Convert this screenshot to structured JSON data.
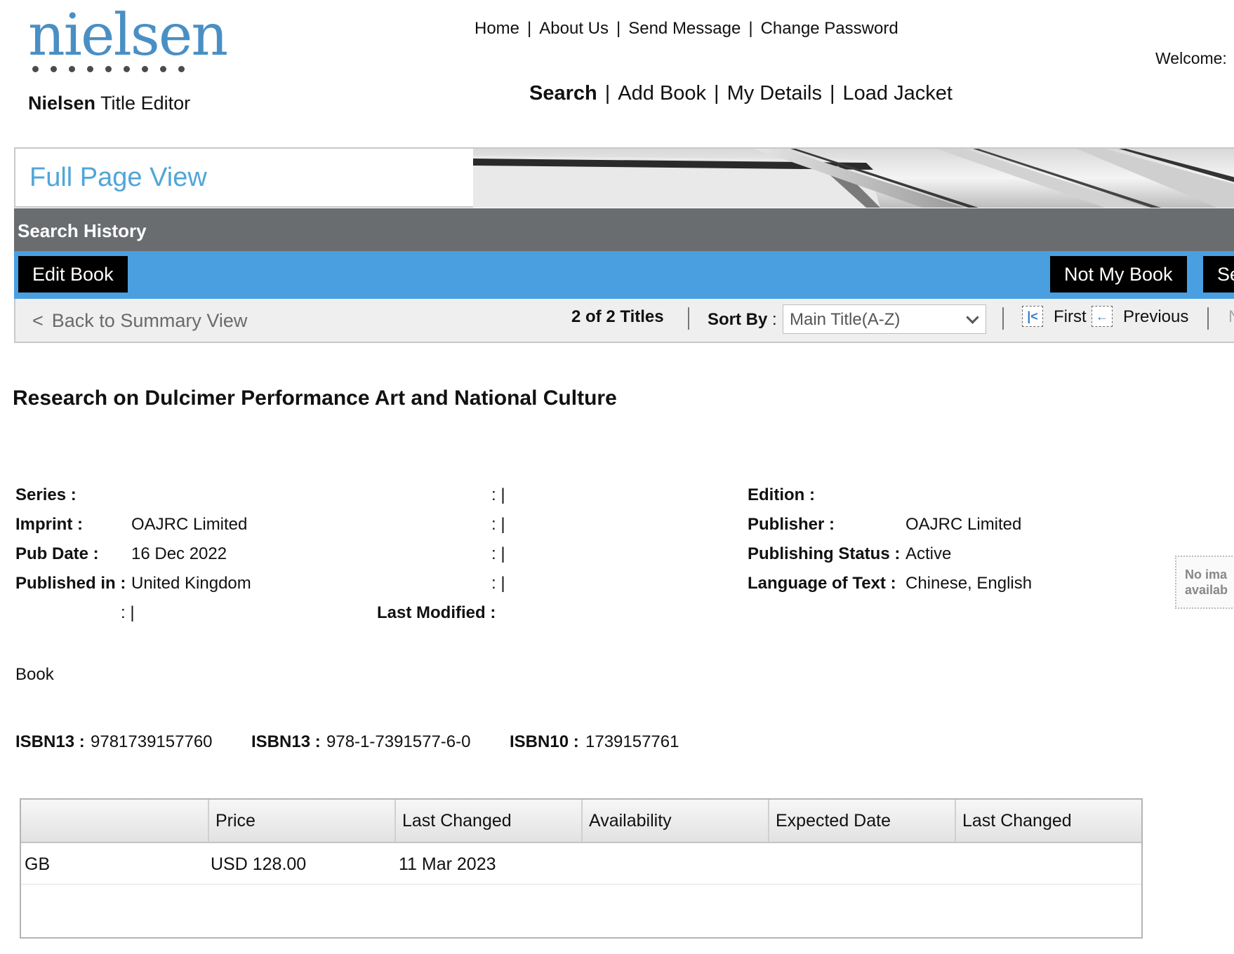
{
  "header": {
    "brand_logo_text": "nielsen",
    "app_title_bold": "Nielsen",
    "app_title_rest": "Title Editor",
    "top_links": [
      "Home",
      "About Us",
      "Send Message",
      "Change Password"
    ],
    "main_links": [
      "Search",
      "Add Book",
      "My Details",
      "Load Jacket"
    ],
    "welcome": "Welcome:"
  },
  "banner": {
    "title": "Full Page View",
    "history_label": "Search History"
  },
  "actions": {
    "edit_book": "Edit Book",
    "not_my_book": "Not My Book",
    "cut_button": "Se"
  },
  "pager": {
    "back_arrow": "<",
    "back_label": "Back to Summary View",
    "titles_count": "2 of 2 Titles",
    "sort_by_label": "Sort By",
    "sort_by_colon": ":",
    "sort_selected": "Main Title(A-Z)",
    "first_label": "First",
    "previous_label": "Previous",
    "next_partial": "N"
  },
  "book": {
    "title": "Research on Dulcimer Performance Art and National Culture",
    "series_label": "Series :",
    "series_value": "",
    "imprint_label": "Imprint :",
    "imprint_value": "OAJRC Limited",
    "pub_date_label": "Pub Date :",
    "pub_date_value": "16 Dec 2022",
    "published_in_label": "Published in :",
    "published_in_value": "United Kingdom",
    "colon_bar": ": |",
    "last_modified_label": "Last Modified :",
    "edition_label": "Edition :",
    "edition_value": "",
    "publisher_label": "Publisher :",
    "publisher_value": "OAJRC Limited",
    "publishing_status_label": "Publishing Status :",
    "publishing_status_value": "Active",
    "language_label": "Language of Text :",
    "language_value": "Chinese, English",
    "no_image_line1": "No ima",
    "no_image_line2": "availab",
    "format": "Book",
    "isbn13_label": "ISBN13 :",
    "isbn13_value": "9781739157760",
    "isbn13_hyph_label": "ISBN13 :",
    "isbn13_hyph_value": "978-1-7391577-6-0",
    "isbn10_label": "ISBN10 :",
    "isbn10_value": "1739157761"
  },
  "price_table": {
    "headers": [
      "",
      "Price",
      "Last Changed",
      "Availability",
      "Expected Date",
      "Last Changed"
    ],
    "rows": [
      [
        "GB",
        "USD 128.00",
        "11 Mar 2023",
        "",
        "",
        ""
      ]
    ]
  },
  "colors": {
    "accent_blue": "#4a9fe1",
    "banner_title": "#4fa6d8",
    "history_gray": "#6a6d70"
  }
}
